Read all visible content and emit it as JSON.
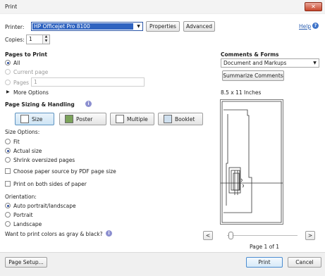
{
  "window": {
    "title": "Print",
    "close_symbol": "✕"
  },
  "printer": {
    "label": "Printer:",
    "value": "HP Officejet Pro 8100",
    "properties_label": "Properties",
    "advanced_label": "Advanced"
  },
  "help": {
    "label": "Help"
  },
  "copies": {
    "label": "Copies:",
    "value": "1"
  },
  "pages": {
    "heading": "Pages to Print",
    "options": [
      "All",
      "Current page",
      "Pages"
    ],
    "selected": "All",
    "pages_value": "1",
    "more_options": "More Options"
  },
  "sizing": {
    "heading": "Page Sizing & Handling",
    "tabs": [
      "Size",
      "Poster",
      "Multiple",
      "Booklet"
    ],
    "selected_tab": "Size",
    "size_options_label": "Size Options:",
    "size_options": [
      "Fit",
      "Actual size",
      "Shrink oversized pages"
    ],
    "selected_size": "Actual size",
    "choose_source": "Choose paper source by PDF page size",
    "both_sides": "Print on both sides of paper"
  },
  "orientation": {
    "label": "Orientation:",
    "options": [
      "Auto portrait/landscape",
      "Portrait",
      "Landscape"
    ],
    "selected": "Auto portrait/landscape"
  },
  "gray_question": "Want to print colors as gray & black?",
  "comments": {
    "heading": "Comments & Forms",
    "value": "Document and Markups",
    "summarize_label": "Summarize Comments",
    "paper_size": "8.5 x 11 Inches"
  },
  "preview": {
    "page_indicator": "Page 1 of 1",
    "prev_symbol": "<",
    "next_symbol": ">"
  },
  "footer": {
    "page_setup_label": "Page Setup...",
    "print_label": "Print",
    "cancel_label": "Cancel"
  },
  "colors": {
    "accent": "#2f5da8",
    "selected_select": "#2f63c0",
    "link": "#2a5db0"
  }
}
